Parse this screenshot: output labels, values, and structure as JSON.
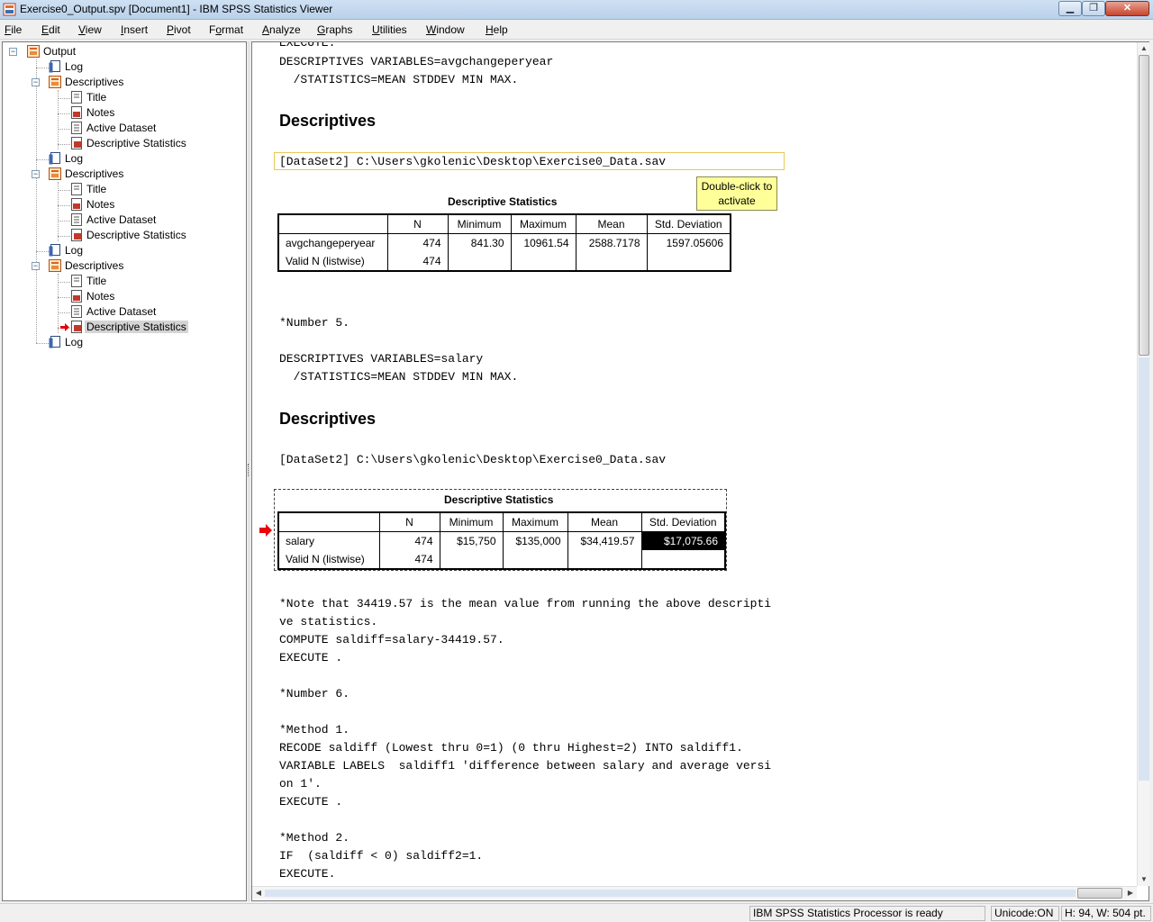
{
  "window": {
    "title": "Exercise0_Output.spv [Document1] - IBM SPSS Statistics Viewer",
    "minimize": "▁",
    "maximize": "❐",
    "close": "✕"
  },
  "menu": [
    {
      "u": "F",
      "rest": "ile"
    },
    {
      "u": "E",
      "rest": "dit"
    },
    {
      "u": "V",
      "rest": "iew"
    },
    {
      "u": "I",
      "rest": "nsert"
    },
    {
      "u": "P",
      "rest": "ivot"
    },
    {
      "u": "",
      "pre": "F",
      "u2": "o",
      "rest": "rmat"
    },
    {
      "u": "A",
      "rest": "nalyze"
    },
    {
      "u": "G",
      "rest": "raphs"
    },
    {
      "u": "U",
      "rest": "tilities"
    },
    {
      "u": "W",
      "rest": "indow"
    },
    {
      "u": "H",
      "rest": "elp"
    }
  ],
  "outline": {
    "root": "Output",
    "log": "Log",
    "descriptives": "Descriptives",
    "title": "Title",
    "notes": "Notes",
    "active_dataset": "Active Dataset",
    "descriptive_statistics": "Descriptive Statistics"
  },
  "content": {
    "syntax_top_cut": "EXECUTE.",
    "syntax_1": "DESCRIPTIVES VARIABLES=avgchangeperyear\n  /STATISTICS=MEAN STDDEV MIN MAX.",
    "heading": "Descriptives",
    "dataset": "[DataSet2] C:\\Users\\gkolenic\\Desktop\\Exercise0_Data.sav",
    "tooltip": "Double-click to activate",
    "table_title": "Descriptive Statistics",
    "columns": [
      "N",
      "Minimum",
      "Maximum",
      "Mean",
      "Std. Deviation"
    ],
    "table1": [
      {
        "label": "avgchangeperyear",
        "values": [
          "474",
          "841.30",
          "10961.54",
          "2588.7178",
          "1597.05606"
        ]
      },
      {
        "label": "Valid N (listwise)",
        "values": [
          "474",
          "",
          "",
          "",
          ""
        ]
      }
    ],
    "syntax_2": "*Number 5.\n\nDESCRIPTIVES VARIABLES=salary\n  /STATISTICS=MEAN STDDEV MIN MAX.",
    "table2": [
      {
        "label": "salary",
        "values": [
          "474",
          "$15,750",
          "$135,000",
          "$34,419.57",
          "$17,075.66"
        ]
      },
      {
        "label": "Valid N (listwise)",
        "values": [
          "474",
          "",
          "",
          "",
          ""
        ]
      }
    ],
    "syntax_3": "*Note that 34419.57 is the mean value from running the above descripti\nve statistics.\nCOMPUTE saldiff=salary-34419.57.\nEXECUTE .\n\n*Number 6.\n\n*Method 1.\nRECODE saldiff (Lowest thru 0=1) (0 thru Highest=2) INTO saldiff1.\nVARIABLE LABELS  saldiff1 'difference between salary and average versi\non 1'.\nEXECUTE .\n\n*Method 2.\nIF  (saldiff < 0) saldiff2=1.\nEXECUTE."
  },
  "status": {
    "processor": "IBM SPSS Statistics Processor is ready",
    "unicode": "Unicode:ON",
    "dims": "H: 94, W: 504 pt."
  },
  "colors": {
    "accent_arrow": "#e8000b",
    "selected_cell": "#000000",
    "tooltip_bg": "#ffff99"
  }
}
